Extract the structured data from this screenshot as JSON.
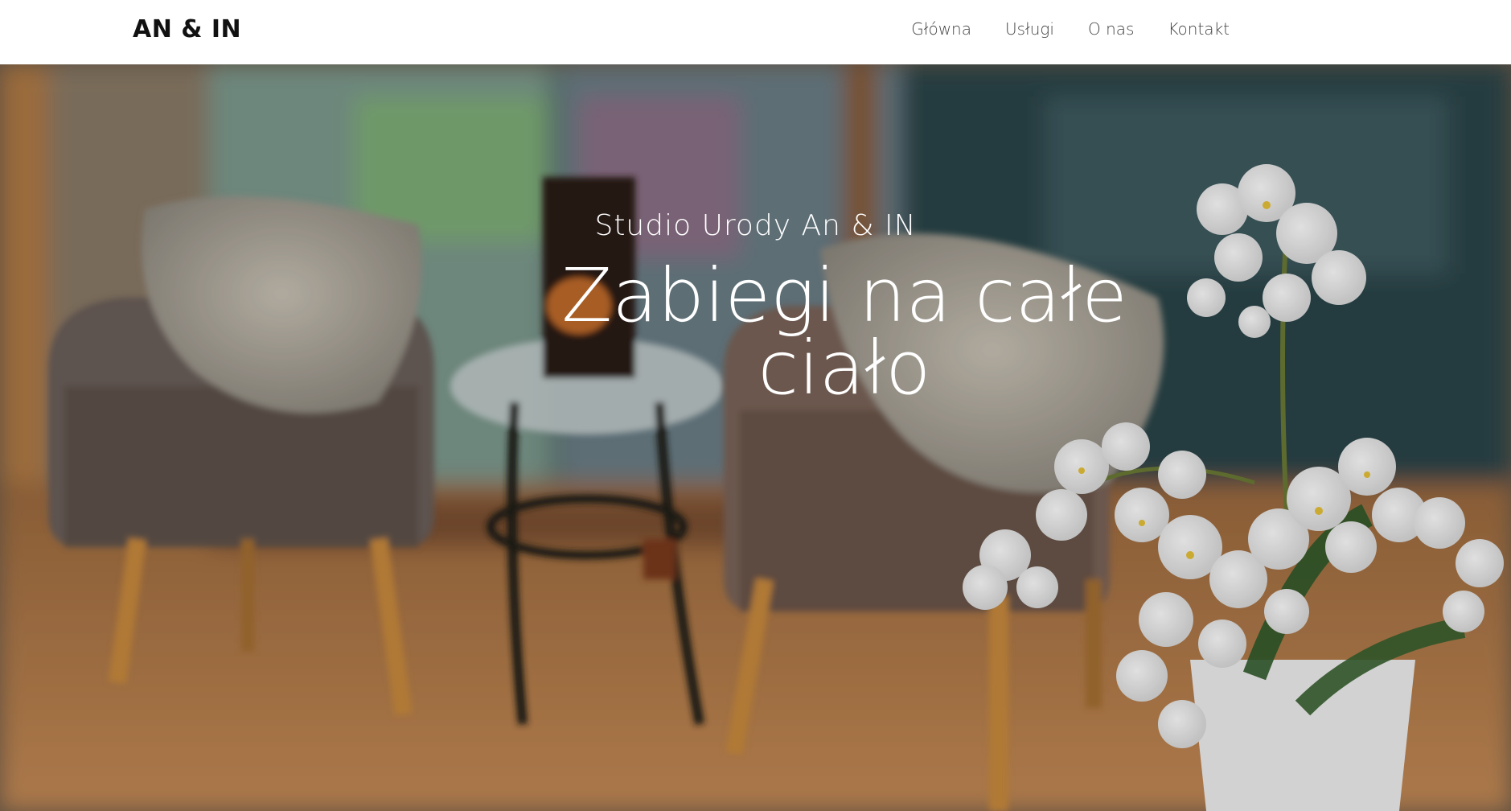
{
  "brand": {
    "name": "AN & IN"
  },
  "nav": {
    "items": [
      {
        "label": "Główna"
      },
      {
        "label": "Usługi"
      },
      {
        "label": "O nas"
      },
      {
        "label": "Kontakt"
      }
    ]
  },
  "hero": {
    "subtitle": "Studio Urody An & IN",
    "title": "Zabiegi na całe ciało"
  }
}
